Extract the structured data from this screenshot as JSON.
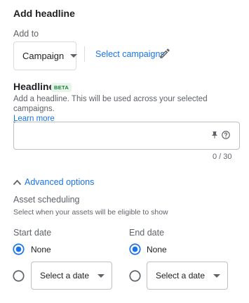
{
  "panel": {
    "title": "Add headline",
    "add_to_label": "Add to",
    "add_to_value": "Campaign",
    "select_campaigns_link": "Select campaigns"
  },
  "headline": {
    "label": "Headline",
    "badge": "BETA",
    "helper_text": "Add a headline. This will be used across your selected campaigns.",
    "learn_more": "Learn more",
    "value": "",
    "counter": "0 / 30"
  },
  "advanced": {
    "toggle_label": "Advanced options",
    "asset_scheduling_title": "Asset scheduling",
    "asset_scheduling_subtitle": "Select when your assets will be eligible to show",
    "start_date": {
      "label": "Start date",
      "none_label": "None",
      "none_selected": true,
      "select_placeholder": "Select a date"
    },
    "end_date": {
      "label": "End date",
      "none_label": "None",
      "none_selected": true,
      "select_placeholder": "Select a date"
    }
  },
  "colors": {
    "accent": "#1a73e8",
    "beta_text": "#188038",
    "beta_bg": "#e6f4ea",
    "border": "#bdc1c6",
    "muted_text": "#5f6368"
  },
  "icons": {
    "edit": "pencil-icon",
    "pin": "pin-icon",
    "help": "help-circle-icon",
    "collapse": "chevron-up-icon",
    "dropdown": "caret-down-icon"
  }
}
